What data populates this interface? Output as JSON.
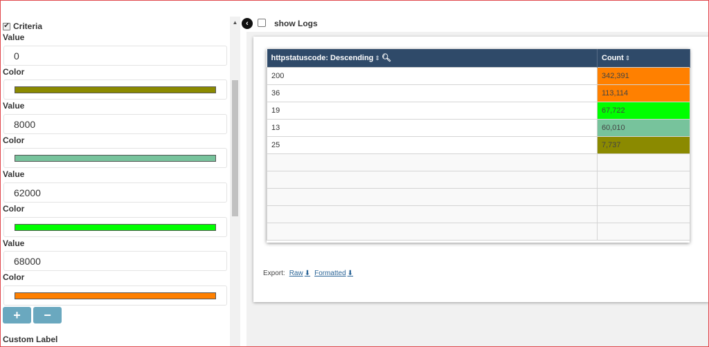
{
  "criteria": {
    "label": "Criteria",
    "checked": true
  },
  "thresholds": [
    {
      "value_label": "Value",
      "value": "0",
      "color_label": "Color",
      "color": "#8b8a00"
    },
    {
      "value_label": "Value",
      "value": "8000",
      "color_label": "Color",
      "color": "#77c39c"
    },
    {
      "value_label": "Value",
      "value": "62000",
      "color_label": "Color",
      "color": "#00ff00"
    },
    {
      "value_label": "Value",
      "value": "68000",
      "color_label": "Color",
      "color": "#ff8000"
    }
  ],
  "buttons": {
    "add": "+",
    "remove": "−"
  },
  "custom_label": "Custom Label",
  "logs": {
    "label": "show Logs",
    "checked": false
  },
  "table": {
    "columns": [
      "httpstatuscode: Descending",
      "Count"
    ],
    "rows": [
      {
        "code": "200",
        "count": "342,391",
        "color": "#ff8000"
      },
      {
        "code": "36",
        "count": "113,114",
        "color": "#ff8000"
      },
      {
        "code": "19",
        "count": "67,722",
        "color": "#00ff00"
      },
      {
        "code": "13",
        "count": "60,010",
        "color": "#77c39c"
      },
      {
        "code": "25",
        "count": "7,737",
        "color": "#8b8a00"
      }
    ],
    "empty_rows": 5
  },
  "export": {
    "label": "Export:",
    "raw": "Raw",
    "formatted": "Formatted"
  }
}
